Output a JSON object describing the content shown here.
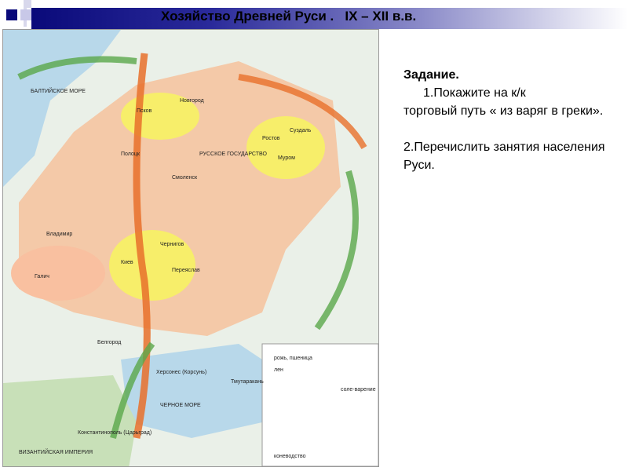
{
  "header": {
    "title": "Хозяйство Древней Руси .   IX – XII в.в."
  },
  "map": {
    "cities": [
      "Новгород",
      "Псков",
      "Полоцк",
      "Смоленск",
      "Ростов",
      "Суздаль",
      "Муром",
      "Чернигов",
      "Киев",
      "Галич",
      "Владимир",
      "Переяслав",
      "Тмутаракань",
      "Херсонес (Корсунь)",
      "Белгород",
      "Константинополь (Царьград)"
    ],
    "regions": [
      "БАЛТИЙСКОЕ МОРЕ",
      "РУССКОЕ ГОСУДАРСТВО",
      "ЧЕРНОЕ МОРЕ",
      "ВИЗАНТИЙСКАЯ ИМПЕРИЯ"
    ],
    "legend": [
      "рожь, пшеница",
      "лен",
      "соле-варение",
      "коневодство"
    ]
  },
  "task": {
    "heading": "Задание.",
    "item1_a": "1.Покажите на к/к",
    "item1_b": "торговый путь « из варяг в греки».",
    "item2": "2.Перечислить занятия населения Руси."
  },
  "colors": {
    "band_dark": "#0a0a7a",
    "territory": "#f4c9a8",
    "yellow": "#f7ee6a",
    "sea": "#b8d8ea",
    "arrow_orange": "#e8702a",
    "arrow_green": "#5aa84a"
  }
}
